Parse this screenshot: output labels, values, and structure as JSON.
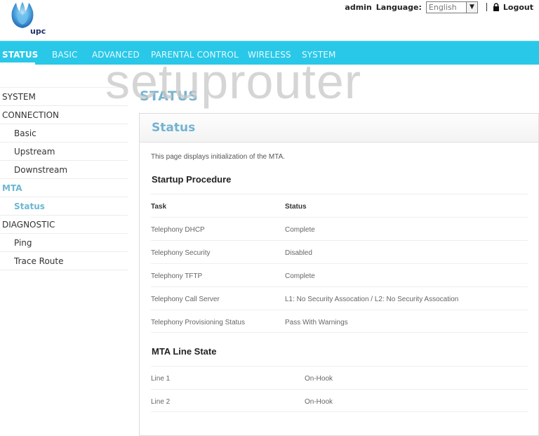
{
  "brand": {
    "logo_text": "upc",
    "logo_icon": "upc-flower-logo-icon"
  },
  "topbar": {
    "user": "admin",
    "language_label": "Language:",
    "language_value": "English",
    "lock_icon": "lock-icon",
    "logout_label": "Logout"
  },
  "nav": {
    "items": [
      {
        "label": "STATUS",
        "active": true
      },
      {
        "label": "BASIC"
      },
      {
        "label": "ADVANCED"
      },
      {
        "label": "PARENTAL CONTROL"
      },
      {
        "label": "WIRELESS"
      },
      {
        "label": "SYSTEM"
      }
    ]
  },
  "watermark": "setuprouter",
  "sidebar": {
    "items": [
      {
        "label": "SYSTEM"
      },
      {
        "label": "CONNECTION"
      },
      {
        "label": "Basic",
        "sub": true
      },
      {
        "label": "Upstream",
        "sub": true
      },
      {
        "label": "Downstream",
        "sub": true
      },
      {
        "label": "MTA",
        "active": true
      },
      {
        "label": "Status",
        "sub": true,
        "active": true
      },
      {
        "label": "DIAGNOSTIC"
      },
      {
        "label": "Ping",
        "sub": true
      },
      {
        "label": "Trace Route",
        "sub": true
      }
    ]
  },
  "main": {
    "page_heading": "STATUS",
    "panel_title": "Status",
    "description": "This page displays initialization of the MTA.",
    "startup": {
      "title": "Startup Procedure",
      "columns": [
        "Task",
        "Status"
      ],
      "rows": [
        [
          "Telephony DHCP",
          "Complete"
        ],
        [
          "Telephony Security",
          "Disabled"
        ],
        [
          "Telephony TFTP",
          "Complete"
        ],
        [
          "Telephony Call Server",
          "L1: No Security Assocation / L2: No Security Assocation"
        ],
        [
          "Telephony Provisioning Status",
          "Pass With Warnings"
        ]
      ]
    },
    "line_state": {
      "title": "MTA Line State",
      "rows": [
        [
          "Line 1",
          "On-Hook"
        ],
        [
          "Line 2",
          "On-Hook"
        ]
      ]
    }
  },
  "colors": {
    "nav_bg": "#29c8e8",
    "accent": "#72b3d0"
  }
}
